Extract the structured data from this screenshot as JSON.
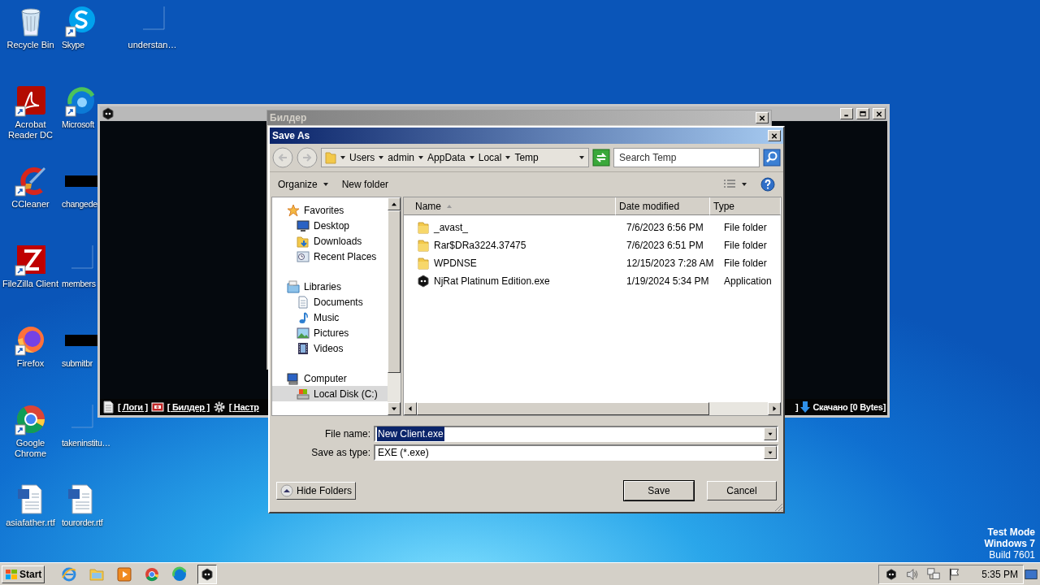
{
  "desktop_icons": [
    {
      "label": "Recycle Bin",
      "kind": "recycle",
      "shortcut": false
    },
    {
      "label": "Acrobat Reader DC",
      "kind": "acrobat",
      "shortcut": true
    },
    {
      "label": "CCleaner",
      "kind": "ccleaner",
      "shortcut": true
    },
    {
      "label": "FileZilla Client",
      "kind": "filezilla",
      "shortcut": true
    },
    {
      "label": "Firefox",
      "kind": "firefox",
      "shortcut": true
    },
    {
      "label": "Google Chrome",
      "kind": "chrome",
      "shortcut": true
    },
    {
      "label": "asiafather.rtf",
      "kind": "doc",
      "shortcut": false
    },
    {
      "label": "Skype",
      "kind": "skype",
      "shortcut": true
    },
    {
      "label": "Microsoft",
      "kind": "edge",
      "shortcut": true
    },
    {
      "label": "changede",
      "kind": "thumb",
      "shortcut": false
    },
    {
      "label": "members",
      "kind": "blank",
      "shortcut": false
    },
    {
      "label": "submitbr",
      "kind": "thumb",
      "shortcut": false
    },
    {
      "label": "takeninstitu…",
      "kind": "blank",
      "shortcut": false
    },
    {
      "label": "tourorder.rtf",
      "kind": "doc",
      "shortcut": false
    },
    {
      "label": "understan…",
      "kind": "blank",
      "shortcut": false
    }
  ],
  "os_notice": [
    "Test Mode",
    "Windows 7",
    "Build 7601"
  ],
  "njrat_window": {
    "status_items": [
      {
        "label": "[ Логи ]",
        "kind": "logs"
      },
      {
        "label": "[ Билдер ]",
        "kind": "builder"
      },
      {
        "label": "[ Настр",
        "kind": "settings"
      }
    ],
    "fragment": "]",
    "download_status": "Скачано [0 Bytes]"
  },
  "builder_window": {
    "title": "Билдер"
  },
  "save_dialog": {
    "title": "Save As",
    "breadcrumb": [
      "Users",
      "admin",
      "AppData",
      "Local",
      "Temp"
    ],
    "search": {
      "placeholder": "Search Temp"
    },
    "toolbar": {
      "organize": "Organize",
      "new_folder": "New folder"
    },
    "navigation": [
      {
        "label": "Favorites",
        "kind": "favorites",
        "selected": false,
        "children": [
          {
            "label": "Desktop",
            "kind": "desktop",
            "selected": false
          },
          {
            "label": "Downloads",
            "kind": "downloads",
            "selected": false
          },
          {
            "label": "Recent Places",
            "kind": "recent",
            "selected": false
          }
        ]
      },
      {
        "label": "Libraries",
        "kind": "libraries",
        "selected": false,
        "children": [
          {
            "label": "Documents",
            "kind": "documents",
            "selected": false
          },
          {
            "label": "Music",
            "kind": "music",
            "selected": false
          },
          {
            "label": "Pictures",
            "kind": "pictures",
            "selected": false
          },
          {
            "label": "Videos",
            "kind": "videos",
            "selected": false
          }
        ]
      },
      {
        "label": "Computer",
        "kind": "computer",
        "selected": false,
        "children": [
          {
            "label": "Local Disk (C:)",
            "kind": "disk",
            "selected": true
          }
        ]
      }
    ],
    "columns": [
      {
        "label": "Name",
        "sorted": true
      },
      {
        "label": "Date modified",
        "sorted": false
      },
      {
        "label": "Type",
        "sorted": false
      }
    ],
    "files": [
      {
        "name": "_avast_",
        "date": "7/6/2023 6:56 PM",
        "type": "File folder",
        "kind": "folder",
        "selected": false
      },
      {
        "name": "Rar$DRa3224.37475",
        "date": "7/6/2023 6:51 PM",
        "type": "File folder",
        "kind": "folder",
        "selected": false
      },
      {
        "name": "WPDNSE",
        "date": "12/15/2023 7:28 AM",
        "type": "File folder",
        "kind": "folder",
        "selected": false
      },
      {
        "name": "NjRat Platinum Edition.exe",
        "date": "1/19/2024 5:34 PM",
        "type": "Application",
        "kind": "app",
        "selected": false
      }
    ],
    "file_name_label": "File name:",
    "file_name": "New Client.exe",
    "file_name_selected": true,
    "type_label": "Save as type:",
    "save_as_type": "EXE (*.exe)",
    "hide_folders": "Hide Folders",
    "buttons": [
      {
        "label": "Save",
        "default": true
      },
      {
        "label": "Cancel",
        "default": false
      }
    ]
  },
  "taskbar": {
    "start": "Start",
    "apps": [
      {
        "kind": "ie",
        "active": false
      },
      {
        "kind": "explorer",
        "active": false
      },
      {
        "kind": "media",
        "active": false
      },
      {
        "kind": "chrome",
        "active": false
      },
      {
        "kind": "edge",
        "active": false
      },
      {
        "kind": "njrat",
        "active": true
      }
    ],
    "tray": [
      {
        "kind": "njrat"
      },
      {
        "kind": "volume"
      },
      {
        "kind": "network"
      },
      {
        "kind": "flag"
      }
    ],
    "clock": "5:35 PM"
  }
}
